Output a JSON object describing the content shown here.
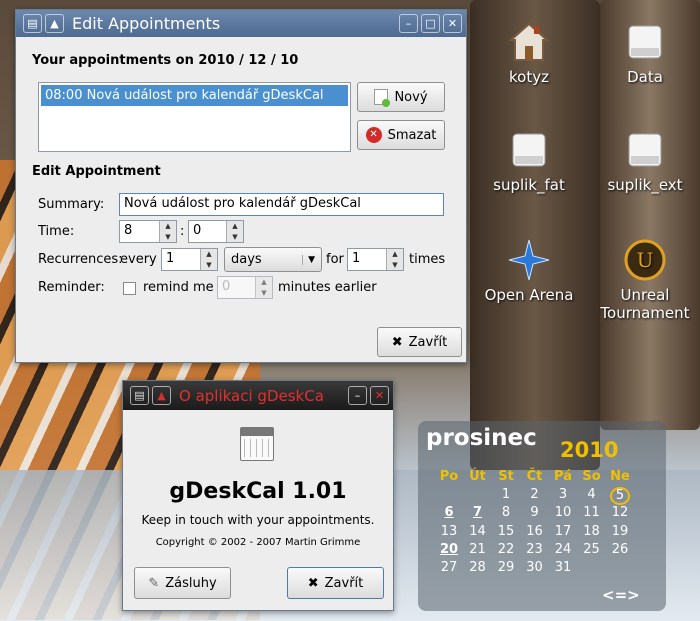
{
  "desktop": {
    "icons": [
      {
        "label": "kotyz"
      },
      {
        "label": "Data"
      },
      {
        "label": "suplik_fat"
      },
      {
        "label": "suplik_ext"
      },
      {
        "label": "Open Arena"
      },
      {
        "label": "Unreal Tournament"
      }
    ]
  },
  "edit_window": {
    "title": "Edit Appointments",
    "heading": "Your appointments on 2010 / 12 / 10",
    "list_items": [
      "08:00  Nová událost pro kalendář gDeskCal"
    ],
    "new_button": "Nový",
    "delete_button": "Smazat",
    "edit_heading": "Edit Appointment",
    "summary_label": "Summary:",
    "summary_value": "Nová událost pro kalendář gDeskCal",
    "time_label": "Time:",
    "time_hour": "8",
    "time_colon": ":",
    "time_minute": "0",
    "recurrences_label": "Recurrences:",
    "every_label": "every",
    "every_value": "1",
    "unit_value": "days",
    "for_label": "for",
    "for_value": "1",
    "times_label": "times",
    "reminder_label": "Reminder:",
    "remind_me_label": "remind me",
    "remind_value": "0",
    "minutes_label": "minutes earlier",
    "close_button": "Zavřít"
  },
  "about_window": {
    "title": "O aplikaci gDeskCa",
    "app_name": "gDeskCal 1.01",
    "tagline": "Keep in touch with your appointments.",
    "copyright": "Copyright © 2002 - 2007 Martin Grimme",
    "credits_button": "Zásluhy",
    "close_button": "Zavřít"
  },
  "calendar": {
    "month": "prosinec",
    "year": "2010",
    "weekdays": [
      "Po",
      "Út",
      "St",
      "Čt",
      "Pá",
      "So",
      "Ne"
    ],
    "weeks": [
      [
        "",
        "",
        "1",
        "2",
        "3",
        "4",
        "5"
      ],
      [
        "6",
        "7",
        "8",
        "9",
        "10",
        "11",
        "12"
      ],
      [
        "13",
        "14",
        "15",
        "16",
        "17",
        "18",
        "19"
      ],
      [
        "20",
        "21",
        "22",
        "23",
        "24",
        "25",
        "26"
      ],
      [
        "27",
        "28",
        "29",
        "30",
        "31",
        "",
        ""
      ]
    ],
    "nav": "<=>",
    "today": "5",
    "colors": {
      "accent": "#f0c000",
      "text": "#ffffff"
    }
  }
}
